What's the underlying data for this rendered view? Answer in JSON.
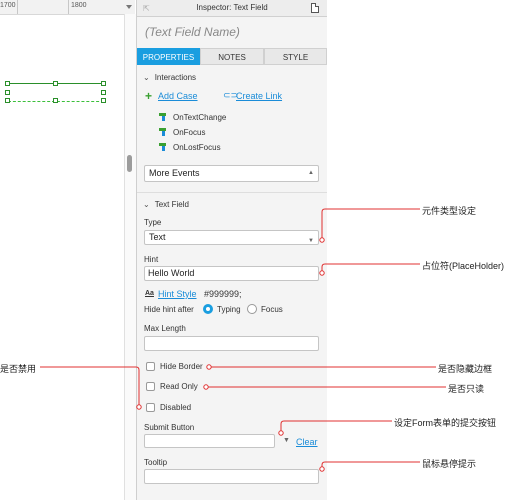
{
  "canvas": {
    "ruler": {
      "labels": [
        "1700",
        "1800"
      ]
    }
  },
  "inspector": {
    "title": "Inspector: Text Field",
    "name_placeholder": "(Text Field Name)",
    "tabs": [
      "PROPERTIES",
      "NOTES",
      "STYLE"
    ],
    "active_tab": "PROPERTIES",
    "interactions": {
      "header": "Interactions",
      "add_case": "Add Case",
      "create_link": "Create Link",
      "events": [
        "OnTextChange",
        "OnFocus",
        "OnLostFocus"
      ],
      "more_events": "More Events"
    },
    "text_field": {
      "header": "Text Field",
      "type_label": "Type",
      "type_value": "Text",
      "hint_label": "Hint",
      "hint_value": "Hello World",
      "hint_style_link": "Hint Style",
      "hint_style_icon": "Aa",
      "hint_color": "#999999;",
      "hide_hint_label": "Hide hint after",
      "hide_hint_options": [
        "Typing",
        "Focus"
      ],
      "hide_hint_selected": "Typing",
      "max_length_label": "Max Length",
      "max_length_value": "",
      "hide_border_label": "Hide Border",
      "hide_border_checked": false,
      "read_only_label": "Read Only",
      "read_only_checked": false,
      "disabled_label": "Disabled",
      "disabled_checked": false,
      "submit_button_label": "Submit Button",
      "submit_button_value": "",
      "clear_link": "Clear",
      "tooltip_label": "Tooltip",
      "tooltip_value": ""
    }
  },
  "annotations": {
    "type": "元件类型设定",
    "hint": "占位符(PlaceHolder)",
    "disabled": "是否禁用",
    "hide_border": "是否隐藏边框",
    "read_only": "是否只读",
    "submit_button": "设定Form表单的提交按钮",
    "tooltip": "鼠标悬停提示"
  },
  "colors": {
    "accent": "#1a9ee0",
    "link": "#1a8cd8",
    "annotation_line": "#e03030",
    "selection_green": "#2a8f2a"
  }
}
